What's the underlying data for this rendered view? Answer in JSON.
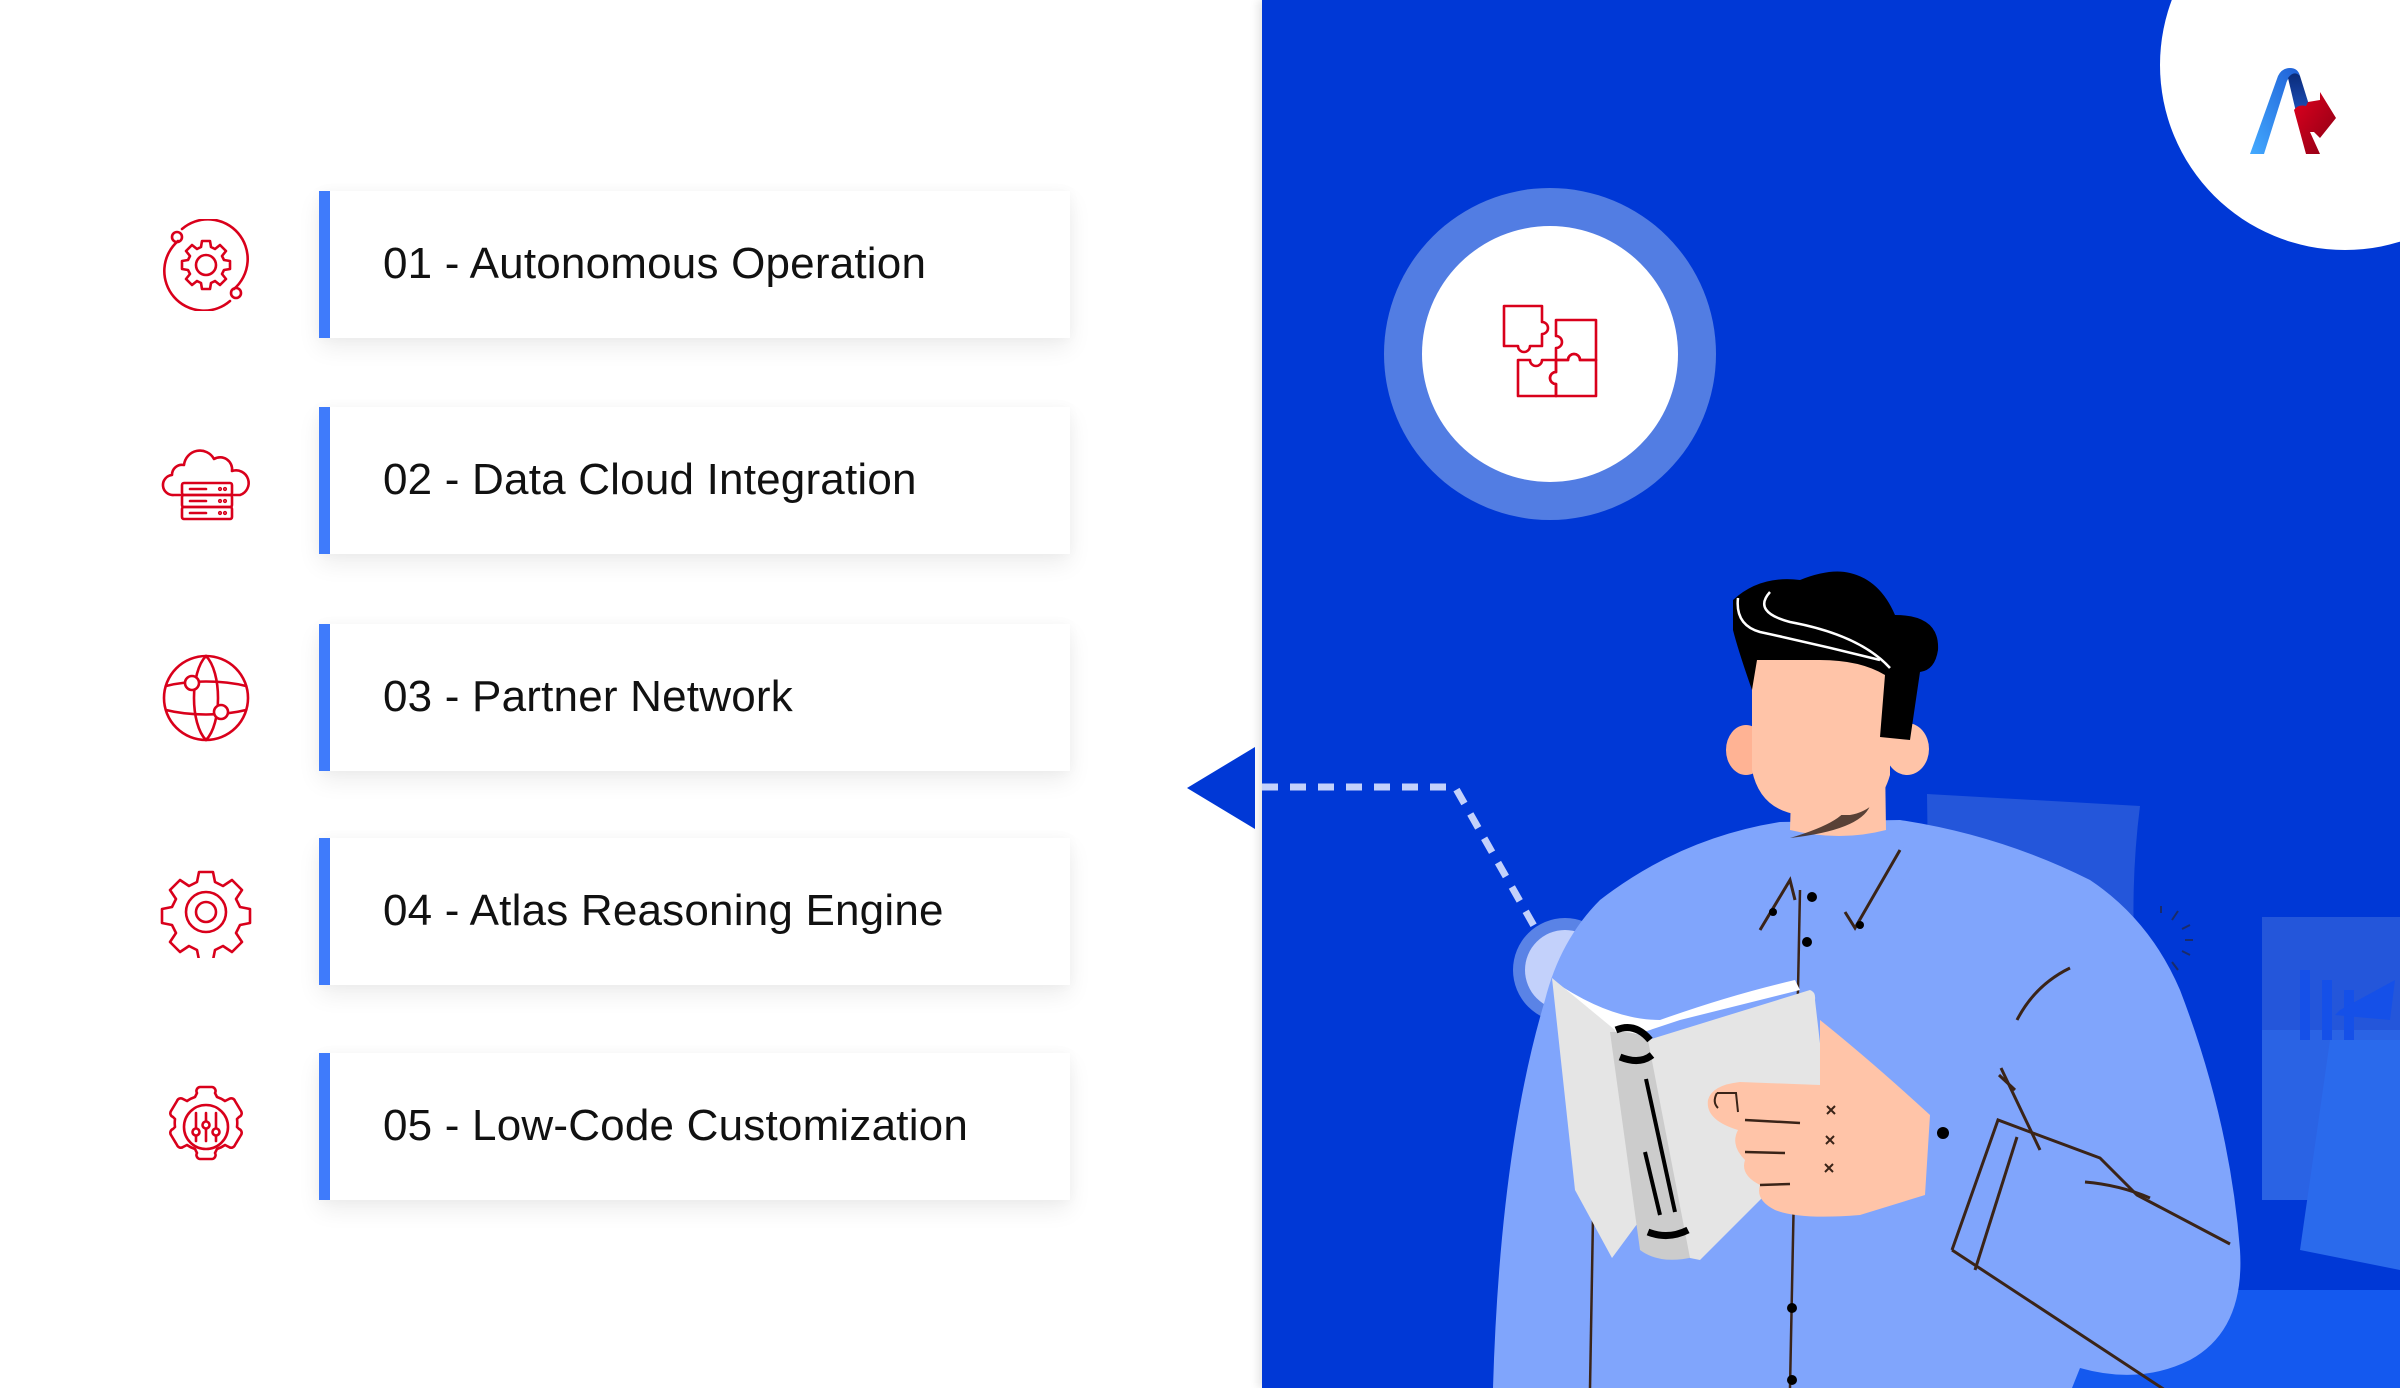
{
  "features": [
    {
      "number": "01",
      "title": "Autonomous Operation",
      "label": "01 - Autonomous Operation",
      "icon": "gear-orbit-icon"
    },
    {
      "number": "02",
      "title": "Data Cloud Integration",
      "label": "02 - Data Cloud Integration",
      "icon": "cloud-server-icon"
    },
    {
      "number": "03",
      "title": "Partner Network",
      "label": "03 - Partner Network",
      "icon": "globe-network-icon"
    },
    {
      "number": "04",
      "title": "Atlas Reasoning Engine",
      "label": "04 - Atlas Reasoning Engine",
      "icon": "gear-engine-icon"
    },
    {
      "number": "05",
      "title": "Low-Code Customization",
      "label": "05 - Low-Code Customization",
      "icon": "gear-sliders-icon"
    }
  ],
  "hero": {
    "center_icon": "puzzle-icon",
    "illustration": "man-reading-book",
    "brand_logo": "brand-logo-icon"
  },
  "colors": {
    "panel_blue": "#0038d6",
    "accent_bar": "#3f7bfb",
    "icon_red": "#d9001b",
    "ring_blue": "#527de3",
    "shirt_blue": "#80a5fc",
    "skin": "#ffc4a8"
  }
}
